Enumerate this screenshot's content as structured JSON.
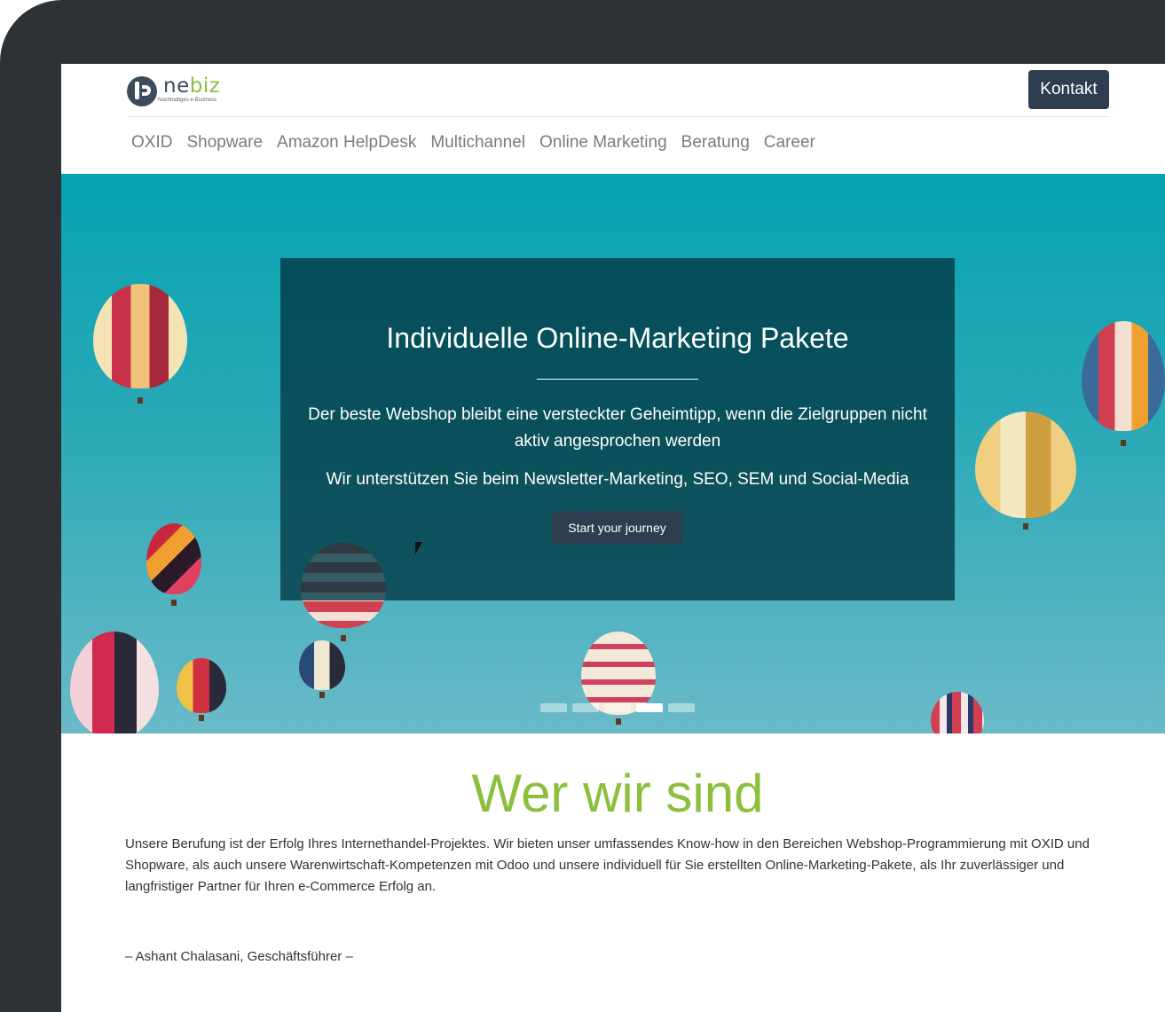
{
  "logo": {
    "brand_pre": "ne",
    "brand_accent": "biz",
    "tagline": "Nachhaltiges e-Business"
  },
  "header": {
    "contact_label": "Kontakt"
  },
  "nav": [
    "OXID",
    "Shopware",
    "Amazon HelpDesk",
    "Multichannel",
    "Online Marketing",
    "Beratung",
    "Career"
  ],
  "hero": {
    "title": "Individuelle Online-Marketing Pakete",
    "paragraph1": "Der beste Webshop bleibt eine versteckter Geheimtipp, wenn die Zielgruppen nicht aktiv angesprochen werden",
    "paragraph2": "Wir unterstützen Sie beim Newsletter-Marketing, SEO, SEM und Social-Media",
    "button": "Start your journey",
    "slides": 5,
    "active_slide": 4
  },
  "about": {
    "title": "Wer wir sind",
    "text": "Unsere Berufung ist der Erfolg Ihres Internethandel-Projektes. Wir bieten unser umfassendes Know-how in den Bereichen Webshop-Programmierung mit OXID und Shopware, als auch unsere Warenwirtschaft-Kompetenzen mit Odoo und unsere individuell für Sie erstellten Online-Marketing-Pakete, als Ihr zuverlässiger und langfristiger Partner für Ihren e-Commerce Erfolg an.",
    "signature": "– Ashant Chalasani, Geschäftsführer –"
  },
  "colors": {
    "accent_green": "#8bbf3c",
    "navy": "#2e3d4f",
    "hero_teal": "#05a2b1",
    "frame": "#2e3237"
  }
}
